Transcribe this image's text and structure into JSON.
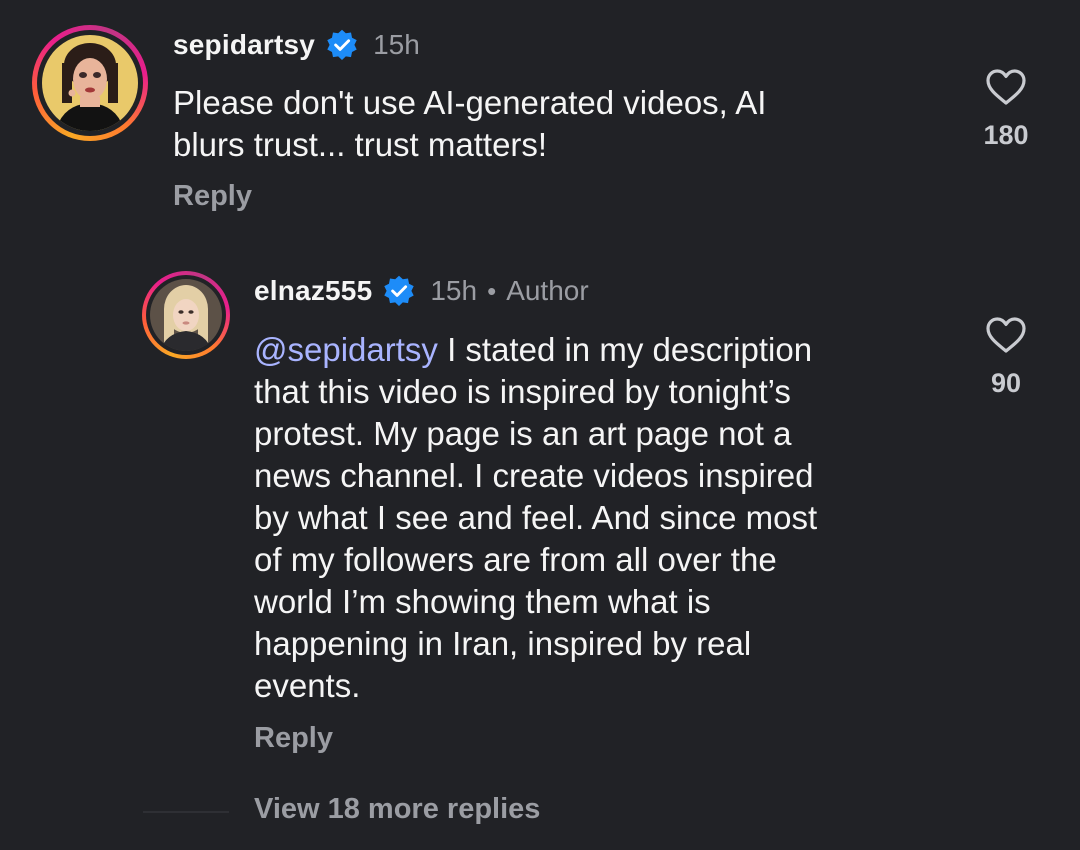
{
  "comments": [
    {
      "username": "sepidartsy",
      "verified": true,
      "timestamp": "15h",
      "text": "Please don't use AI-generated videos, AI\nblurs trust... trust matters!",
      "reply_label": "Reply",
      "likes": "180",
      "avatar": "user-avatar-sepidartsy"
    },
    {
      "username": "elnaz555",
      "verified": true,
      "timestamp": "15h",
      "separator": "•",
      "author_tag": "Author",
      "mention": "@sepidartsy",
      "text": " I stated in my description\nthat this video is inspired by tonight’s\nprotest. My page is an art page not a\nnews channel. I create videos inspired\nby what I see and feel. And since most\nof my followers are from all over the\nworld I’m showing them what is\nhappening in Iran, inspired by real\nevents.",
      "reply_label": "Reply",
      "likes": "90",
      "avatar": "user-avatar-elnaz555"
    }
  ],
  "view_more_label": "View 18 more replies",
  "colors": {
    "background": "#212226",
    "text": "#f5f5f5",
    "muted": "#9b9da3",
    "mention": "#a9b4ff",
    "verified": "#1d8cf8"
  },
  "icons": {
    "verified": "verified-badge-icon",
    "like": "heart-outline-icon"
  }
}
